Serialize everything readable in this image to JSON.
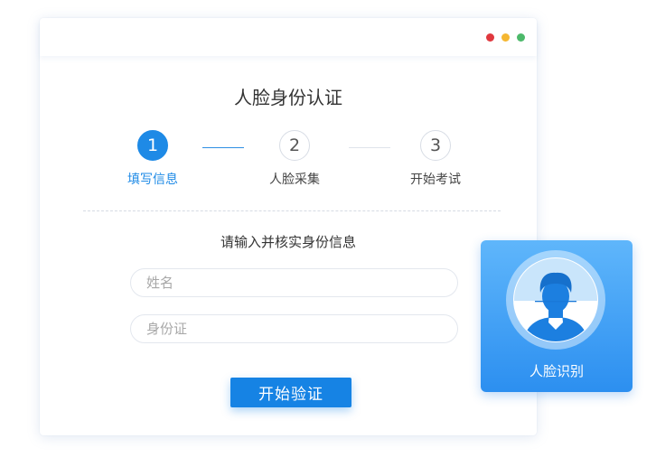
{
  "window": {
    "controls": {
      "close_color": "#e0383e",
      "minimize_color": "#f5b731",
      "maximize_color": "#4cb96a"
    }
  },
  "page_title": "人脸身份认证",
  "steps": [
    {
      "number": "1",
      "label": "填写信息",
      "state": "active"
    },
    {
      "number": "2",
      "label": "人脸采集",
      "state": "pending"
    },
    {
      "number": "3",
      "label": "开始考试",
      "state": "pending"
    }
  ],
  "form": {
    "heading": "请输入并核实身份信息",
    "name_placeholder": "姓名",
    "id_placeholder": "身份证",
    "submit_label": "开始验证"
  },
  "face_card": {
    "label": "人脸识别",
    "icon": "face-scan-icon"
  },
  "colors": {
    "accent": "#1e8ae6",
    "button": "#1683e4"
  }
}
